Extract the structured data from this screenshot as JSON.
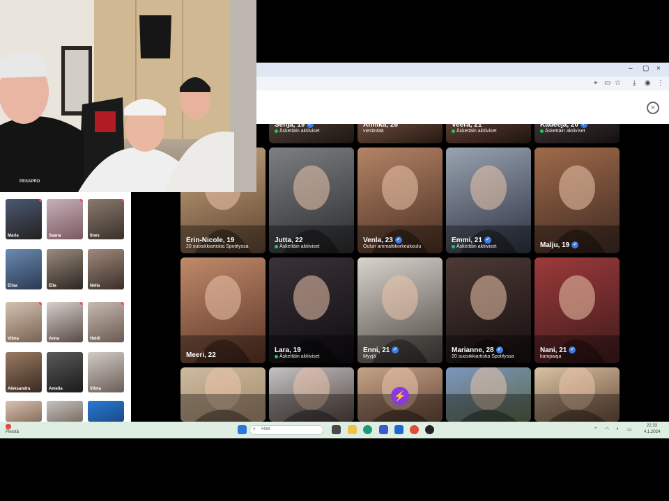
{
  "webcam": {
    "hoodie_text": "PESAPRO"
  },
  "browser": {
    "title_controls": [
      "–",
      "▢",
      "×"
    ],
    "toolbar_icons": [
      "location-icon",
      "cast-icon",
      "star-icon",
      "download-icon",
      "profile-icon",
      "menu-icon"
    ],
    "close_label": "×"
  },
  "cards": [
    {
      "name": "Senja, 19",
      "sub": "Äskettäin aktiiviset",
      "verified": true,
      "active": true,
      "c1": "#4a3b33",
      "c2": "#1c1612"
    },
    {
      "name": "Annika, 26",
      "sub": "viestintää",
      "verified": false,
      "active": false,
      "c1": "#6b4a3a",
      "c2": "#241812"
    },
    {
      "name": "Veera, 21",
      "sub": "Äskettäin aktiiviset",
      "verified": false,
      "active": true,
      "c1": "#5a3a30",
      "c2": "#1e1410"
    },
    {
      "name": "Kadeeja, 20",
      "sub": "Äskettäin aktiiviset",
      "verified": true,
      "active": true,
      "c1": "#3b3030",
      "c2": "#141010"
    },
    {
      "name": "Erin-Nicole, 19",
      "sub": "20 suosikkiartistia Spotifyssa",
      "verified": false,
      "active": false,
      "c1": "#c9a680",
      "c2": "#5e4430"
    },
    {
      "name": "Jutta, 22",
      "sub": "Äskettäin aktiiviset",
      "verified": false,
      "active": true,
      "c1": "#7d7f82",
      "c2": "#2a2b2d"
    },
    {
      "name": "Venla, 23",
      "sub": "Oulun ammattikorkeakoulu",
      "verified": true,
      "active": false,
      "c1": "#b48466",
      "c2": "#4a2e22"
    },
    {
      "name": "Emmi, 21",
      "sub": "Äskettäin aktiiviset",
      "verified": true,
      "active": true,
      "c1": "#9aa3b0",
      "c2": "#2b3242"
    },
    {
      "name": "Malju, 19",
      "sub": "",
      "verified": true,
      "active": false,
      "c1": "#a06a4a",
      "c2": "#3e2a22"
    },
    {
      "name": "Meeri, 22",
      "sub": "",
      "verified": false,
      "active": false,
      "c1": "#c08a6a",
      "c2": "#5a3426"
    },
    {
      "name": "Lara, 19",
      "sub": "Äskettäin aktiiviset",
      "verified": false,
      "active": true,
      "c1": "#3a3238",
      "c2": "#0e0c10"
    },
    {
      "name": "Enni, 21",
      "sub": "Myyjä",
      "verified": true,
      "active": false,
      "c1": "#d8d4cc",
      "c2": "#4b4540"
    },
    {
      "name": "Marianne, 28",
      "sub": "20 suosikkiartistia Spotifyssa",
      "verified": true,
      "active": false,
      "c1": "#4e3a36",
      "c2": "#140e0e"
    },
    {
      "name": "Nani, 21",
      "sub": "kampaaja",
      "verified": true,
      "active": false,
      "c1": "#9c3a3a",
      "c2": "#3e1a1c"
    },
    {
      "name": "",
      "sub": "",
      "verified": false,
      "active": false,
      "c1": "#cdbba0",
      "c2": "#a58a6c"
    },
    {
      "name": "",
      "sub": "",
      "verified": false,
      "active": false,
      "c1": "#c2c2c4",
      "c2": "#5a4a44"
    },
    {
      "name": "",
      "sub": "",
      "verified": false,
      "active": false,
      "c1": "#c4a488",
      "c2": "#6a4a3a"
    },
    {
      "name": "",
      "sub": "",
      "verified": false,
      "active": false,
      "c1": "#7d96c0",
      "c2": "#5a6a4a"
    },
    {
      "name": "",
      "sub": "",
      "verified": false,
      "active": false,
      "c1": "#d8c2a4",
      "c2": "#6b4e3a"
    }
  ],
  "boost_icon": "lightning-icon",
  "sidebar_profiles": [
    {
      "name": "Maria",
      "new": true,
      "c1": "#4a5a74",
      "c2": "#24201e"
    },
    {
      "name": "Saana",
      "new": true,
      "c1": "#c8b0b8",
      "c2": "#7a5a62"
    },
    {
      "name": "Iines",
      "new": true,
      "c1": "#8a7a6e",
      "c2": "#3a302a"
    },
    {
      "name": "Elisa",
      "new": false,
      "c1": "#6a8ab0",
      "c2": "#2a3a52"
    },
    {
      "name": "Ella",
      "new": false,
      "c1": "#9a8a7c",
      "c2": "#2c2622"
    },
    {
      "name": "Nella",
      "new": false,
      "c1": "#a08a7c",
      "c2": "#3a2e2a"
    },
    {
      "name": "Vilma",
      "new": true,
      "c1": "#d2c2b2",
      "c2": "#7a6252"
    },
    {
      "name": "Anna",
      "new": true,
      "c1": "#d6d0cc",
      "c2": "#5a4a44"
    },
    {
      "name": "Heidi",
      "new": true,
      "c1": "#c8bab0",
      "c2": "#6a5a52"
    },
    {
      "name": "Aleksandra",
      "new": false,
      "c1": "#9a7a62",
      "c2": "#3a2a22"
    },
    {
      "name": "Amelia",
      "new": false,
      "c1": "#5a5a5a",
      "c2": "#1a1a1a"
    },
    {
      "name": "Vilma",
      "new": false,
      "c1": "#d2ccc4",
      "c2": "#6a5e58"
    },
    {
      "name": "",
      "new": false,
      "c1": "#d6c2b2",
      "c2": "#8a6e5c"
    },
    {
      "name": "",
      "new": false,
      "c1": "#c6c2be",
      "c2": "#7a6e66"
    },
    {
      "name": "",
      "new": false,
      "c1": "#2a7ad0",
      "c2": "#1a4a8a"
    }
  ],
  "taskbar": {
    "weather_temp": "",
    "weather_desc": "Pilvistä",
    "search_placeholder": "Hae",
    "clock_time": "22.33",
    "clock_date": "4.1.2024",
    "tray_icons": [
      "chevron-up-icon",
      "network-icon",
      "volume-icon",
      "battery-icon"
    ],
    "app_icons": [
      {
        "name": "start-icon",
        "color": "#2b78d8"
      },
      {
        "name": "task-view-icon",
        "color": "#4a4a4a"
      },
      {
        "name": "file-explorer-icon",
        "color": "#f1c24a"
      },
      {
        "name": "edge-icon",
        "color": "#1e9a7a"
      },
      {
        "name": "store-icon",
        "color": "#3a5ad0"
      },
      {
        "name": "outlook-icon",
        "color": "#1a6ad0"
      },
      {
        "name": "chrome-icon",
        "color": "#e14b3a"
      },
      {
        "name": "app-icon",
        "color": "#222222"
      }
    ]
  }
}
